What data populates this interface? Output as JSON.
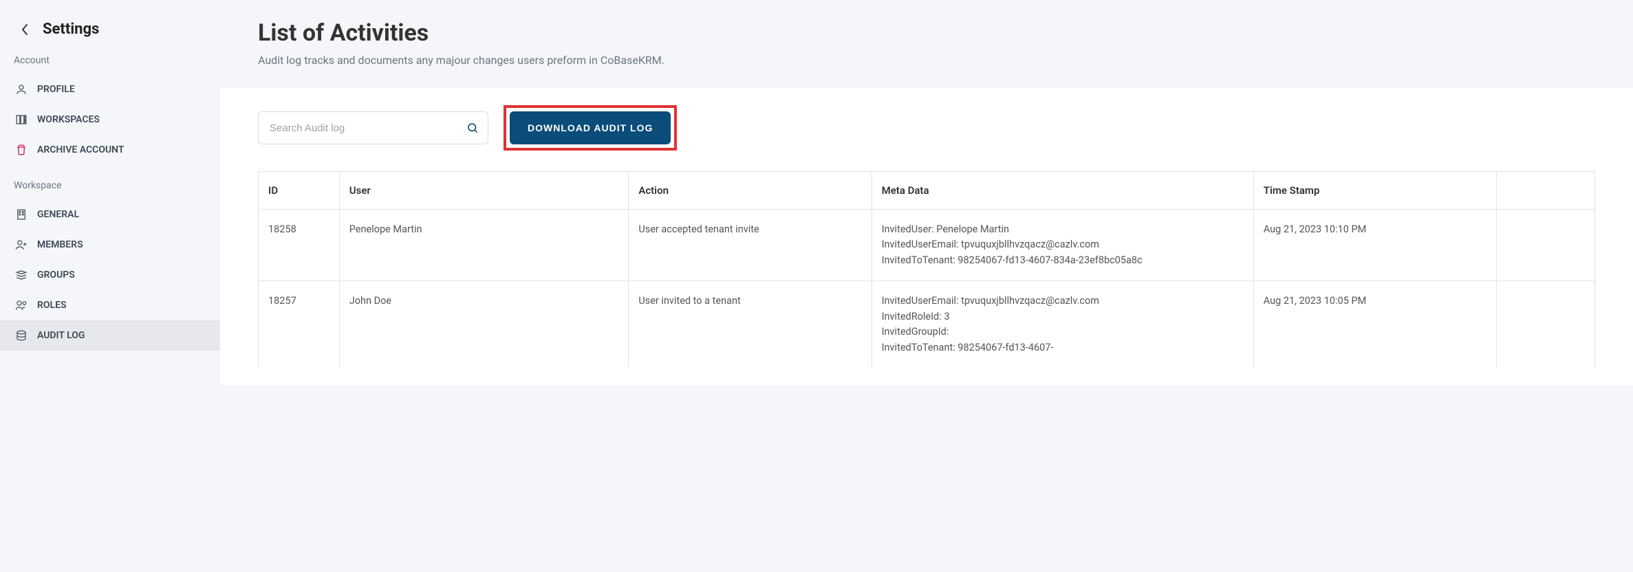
{
  "sidebar": {
    "title": "Settings",
    "sections": [
      {
        "label": "Account",
        "items": [
          {
            "label": "PROFILE",
            "icon": "profile-icon",
            "active": false
          },
          {
            "label": "WORKSPACES",
            "icon": "workspaces-icon",
            "active": false
          },
          {
            "label": "ARCHIVE ACCOUNT",
            "icon": "archive-icon",
            "active": false,
            "danger": true
          }
        ]
      },
      {
        "label": "Workspace",
        "items": [
          {
            "label": "GENERAL",
            "icon": "general-icon",
            "active": false
          },
          {
            "label": "MEMBERS",
            "icon": "members-icon",
            "active": false
          },
          {
            "label": "GROUPS",
            "icon": "groups-icon",
            "active": false
          },
          {
            "label": "ROLES",
            "icon": "roles-icon",
            "active": false
          },
          {
            "label": "AUDIT LOG",
            "icon": "auditlog-icon",
            "active": true
          }
        ]
      }
    ]
  },
  "header": {
    "title": "List of Activities",
    "subtitle": "Audit log tracks and documents any majour changes users preform in CoBaseKRM."
  },
  "toolbar": {
    "search_placeholder": "Search Audit log",
    "download_label": "DOWNLOAD AUDIT LOG"
  },
  "table": {
    "headers": {
      "id": "ID",
      "user": "User",
      "action": "Action",
      "meta": "Meta Data",
      "time": "Time Stamp"
    },
    "rows": [
      {
        "id": "18258",
        "user": "Penelope Martin",
        "action": "User accepted tenant invite",
        "meta": "InvitedUser: Penelope Martin\nInvitedUserEmail: tpvuquxjbllhvzqacz@cazlv.com\nInvitedToTenant: 98254067-fd13-4607-834a-23ef8bc05a8c",
        "time": "Aug 21, 2023 10:10 PM"
      },
      {
        "id": "18257",
        "user": "John Doe",
        "action": "User invited to a tenant",
        "meta": "InvitedUserEmail: tpvuquxjbllhvzqacz@cazlv.com\nInvitedRoleId: 3\nInvitedGroupId:\nInvitedToTenant: 98254067-fd13-4607-",
        "time": "Aug 21, 2023 10:05 PM"
      }
    ]
  }
}
